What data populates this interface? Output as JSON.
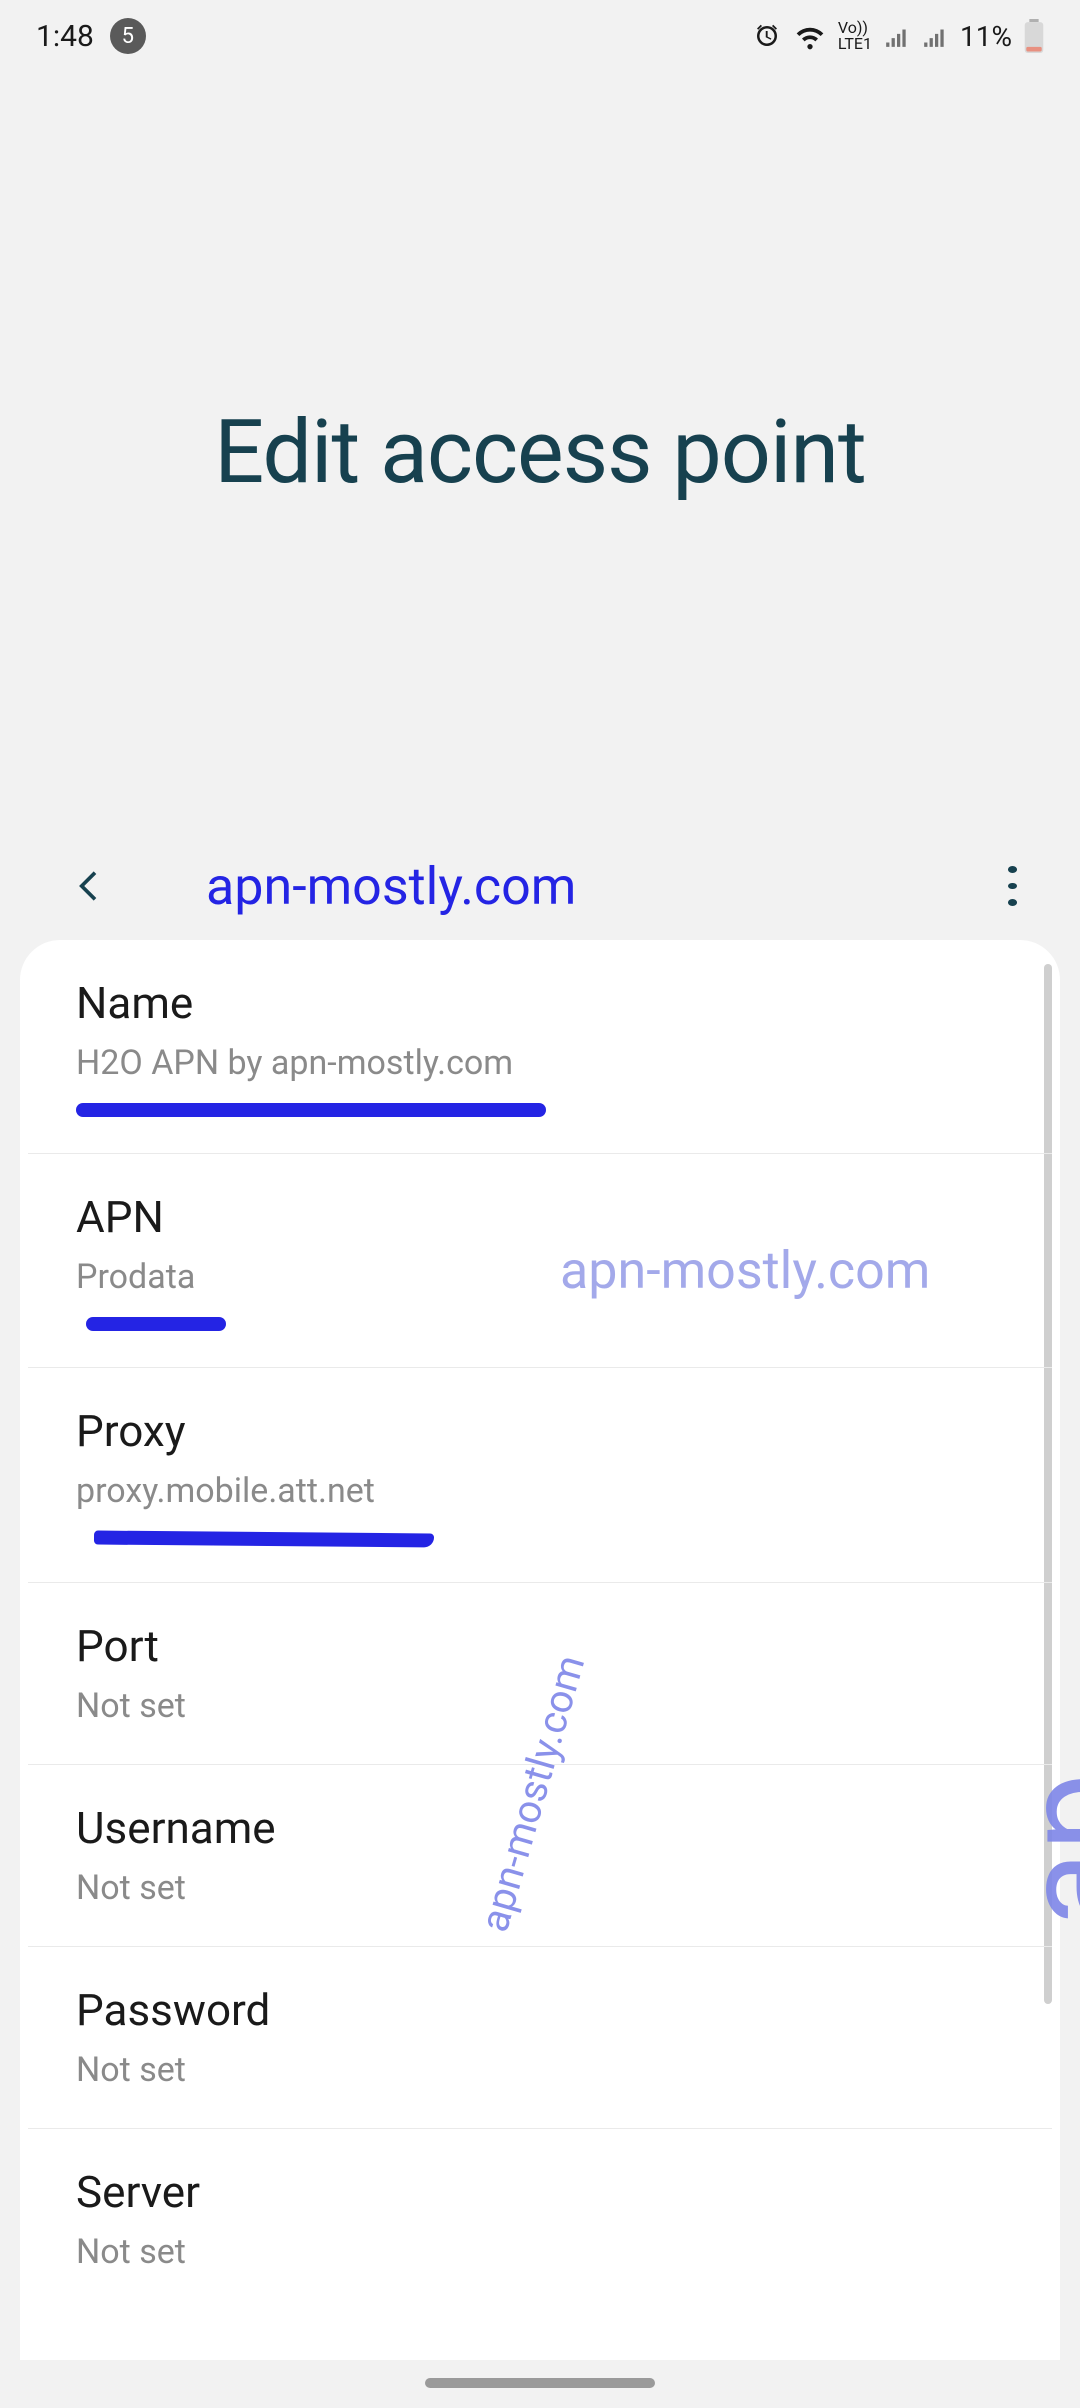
{
  "status_bar": {
    "time": "1:48",
    "notification_count": "5",
    "network_label": "Vo))\nLTE1",
    "battery_percent": "11%"
  },
  "header": {
    "title": "Edit access point"
  },
  "subheader": {
    "brand": "apn-mostly.com"
  },
  "watermarks": {
    "horizontal": "apn-mostly.com",
    "vertical": "apn-mostly.com",
    "side": "ap"
  },
  "settings": [
    {
      "label": "Name",
      "value": "H2O APN by apn-mostly.com"
    },
    {
      "label": "APN",
      "value": "Prodata"
    },
    {
      "label": "Proxy",
      "value": "proxy.mobile.att.net"
    },
    {
      "label": "Port",
      "value": "Not set"
    },
    {
      "label": "Username",
      "value": "Not set"
    },
    {
      "label": "Password",
      "value": "Not set"
    },
    {
      "label": "Server",
      "value": "Not set"
    }
  ]
}
